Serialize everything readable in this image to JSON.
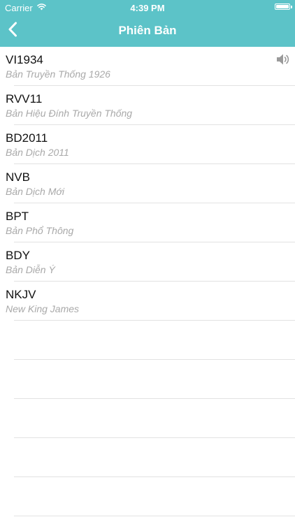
{
  "status_bar": {
    "carrier": "Carrier",
    "time": "4:39 PM",
    "battery_level": 1.0
  },
  "nav": {
    "title": "Phiên Bản",
    "back_icon": "chevron-left-icon"
  },
  "colors": {
    "accent": "#5cc3c8",
    "primary_text": "#111111",
    "secondary_text": "#a9a9a9",
    "separator": "#e2e2e2"
  },
  "versions": [
    {
      "code": "VI1934",
      "name": "Bản Truyền Thống 1926",
      "icon": "speaker-icon"
    },
    {
      "code": "RVV11",
      "name": "Bản Hiệu Đính Truyền Thống"
    },
    {
      "code": "BD2011",
      "name": "Bản Dịch 2011"
    },
    {
      "code": "NVB",
      "name": "Bản Dịch Mới"
    },
    {
      "code": "BPT",
      "name": "Bản Phổ Thông"
    },
    {
      "code": "BDY",
      "name": "Bản Diễn Ý"
    },
    {
      "code": "NKJV",
      "name": "New King James"
    }
  ]
}
